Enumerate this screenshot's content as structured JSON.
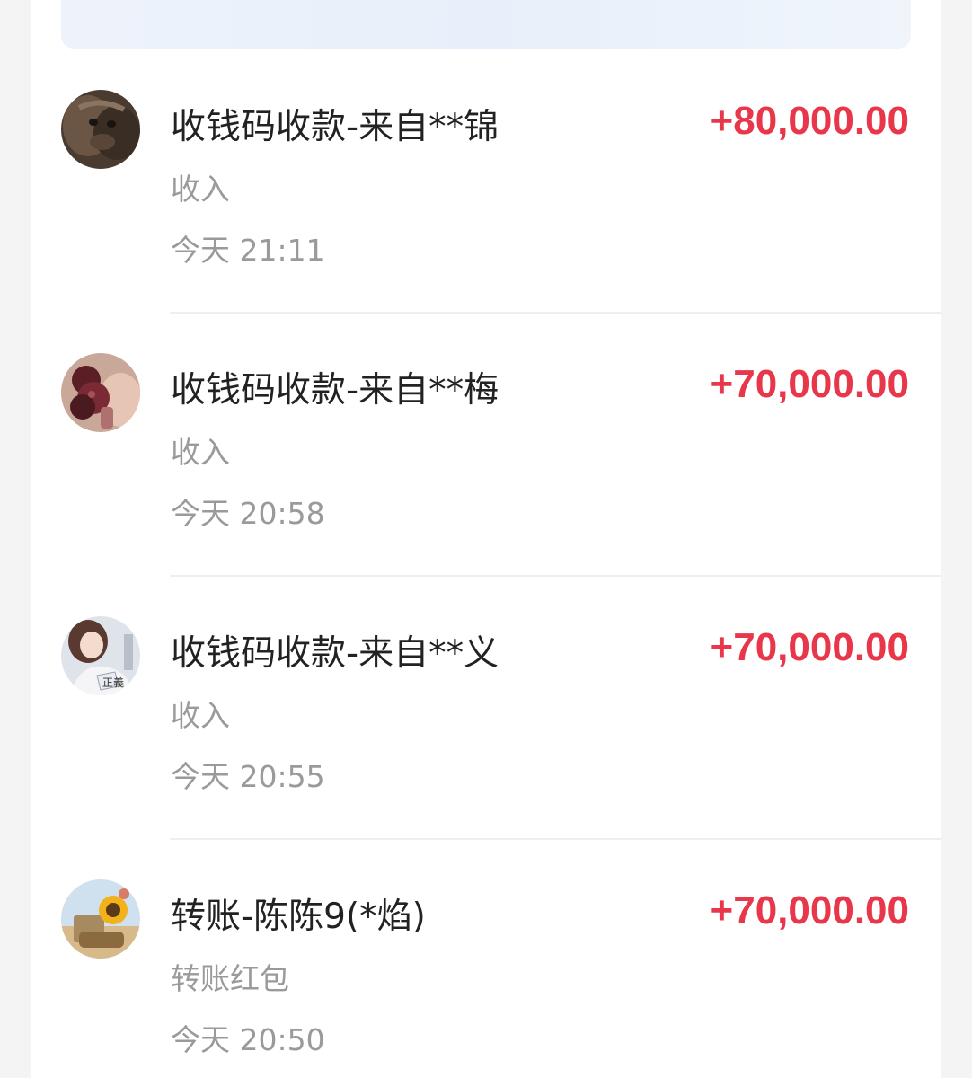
{
  "transactions": [
    {
      "avatar_icon": "monkey-photo-avatar",
      "title": "收钱码收款-来自**锦",
      "category": "收入",
      "time": "今天 21:11",
      "amount": "+80,000.00"
    },
    {
      "avatar_icon": "fruit-photo-avatar",
      "title": "收钱码收款-来自**梅",
      "category": "收入",
      "time": "今天 20:58",
      "amount": "+70,000.00"
    },
    {
      "avatar_icon": "girl-photo-avatar",
      "title": "收钱码收款-来自**义",
      "category": "收入",
      "time": "今天 20:55",
      "amount": "+70,000.00"
    },
    {
      "avatar_icon": "sunflower-photo-avatar",
      "title": "转账-陈陈9(*焰)",
      "category": "转账红包",
      "time": "今天 20:50",
      "amount": "+70,000.00"
    }
  ],
  "colors": {
    "amount": "#e8374a",
    "title": "#222222",
    "meta": "#9a9a9a"
  }
}
